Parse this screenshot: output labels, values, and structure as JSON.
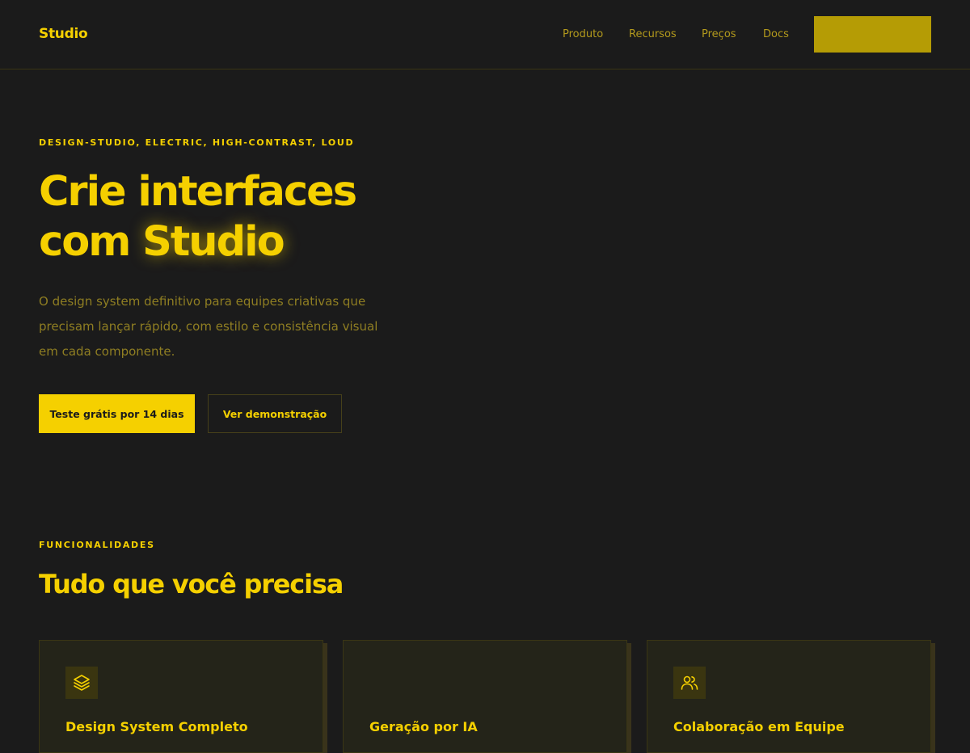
{
  "header": {
    "brand": "Studio",
    "nav": [
      "Produto",
      "Recursos",
      "Preços",
      "Docs"
    ],
    "cta_label": ""
  },
  "hero": {
    "eyebrow": "DESIGN-STUDIO, ELECTRIC, HIGH-CONTRAST, LOUD",
    "title_line1": "Crie interfaces",
    "title_line2_prefix": "com ",
    "title_line2_highlight": "Studio",
    "subtitle": "O design system definitivo para equipes criativas que precisam lançar rápido, com estilo e consistência visual em cada componente.",
    "primary_button": "Teste grátis por 14 dias",
    "secondary_button": "Ver demonstração"
  },
  "features": {
    "eyebrow": "FUNCIONALIDADES",
    "title": "Tudo que você precisa",
    "cards": [
      {
        "icon": "layers-icon",
        "title": "Design System Completo"
      },
      {
        "icon": "",
        "title": "Geração por IA"
      },
      {
        "icon": "users-icon",
        "title": "Colaboração em Equipe"
      }
    ]
  },
  "colors": {
    "background": "#1b1b1b",
    "accent": "#f5d000",
    "muted_text": "#8f7e22",
    "nav_text": "#b39a1c",
    "card_bg": "#242419"
  }
}
